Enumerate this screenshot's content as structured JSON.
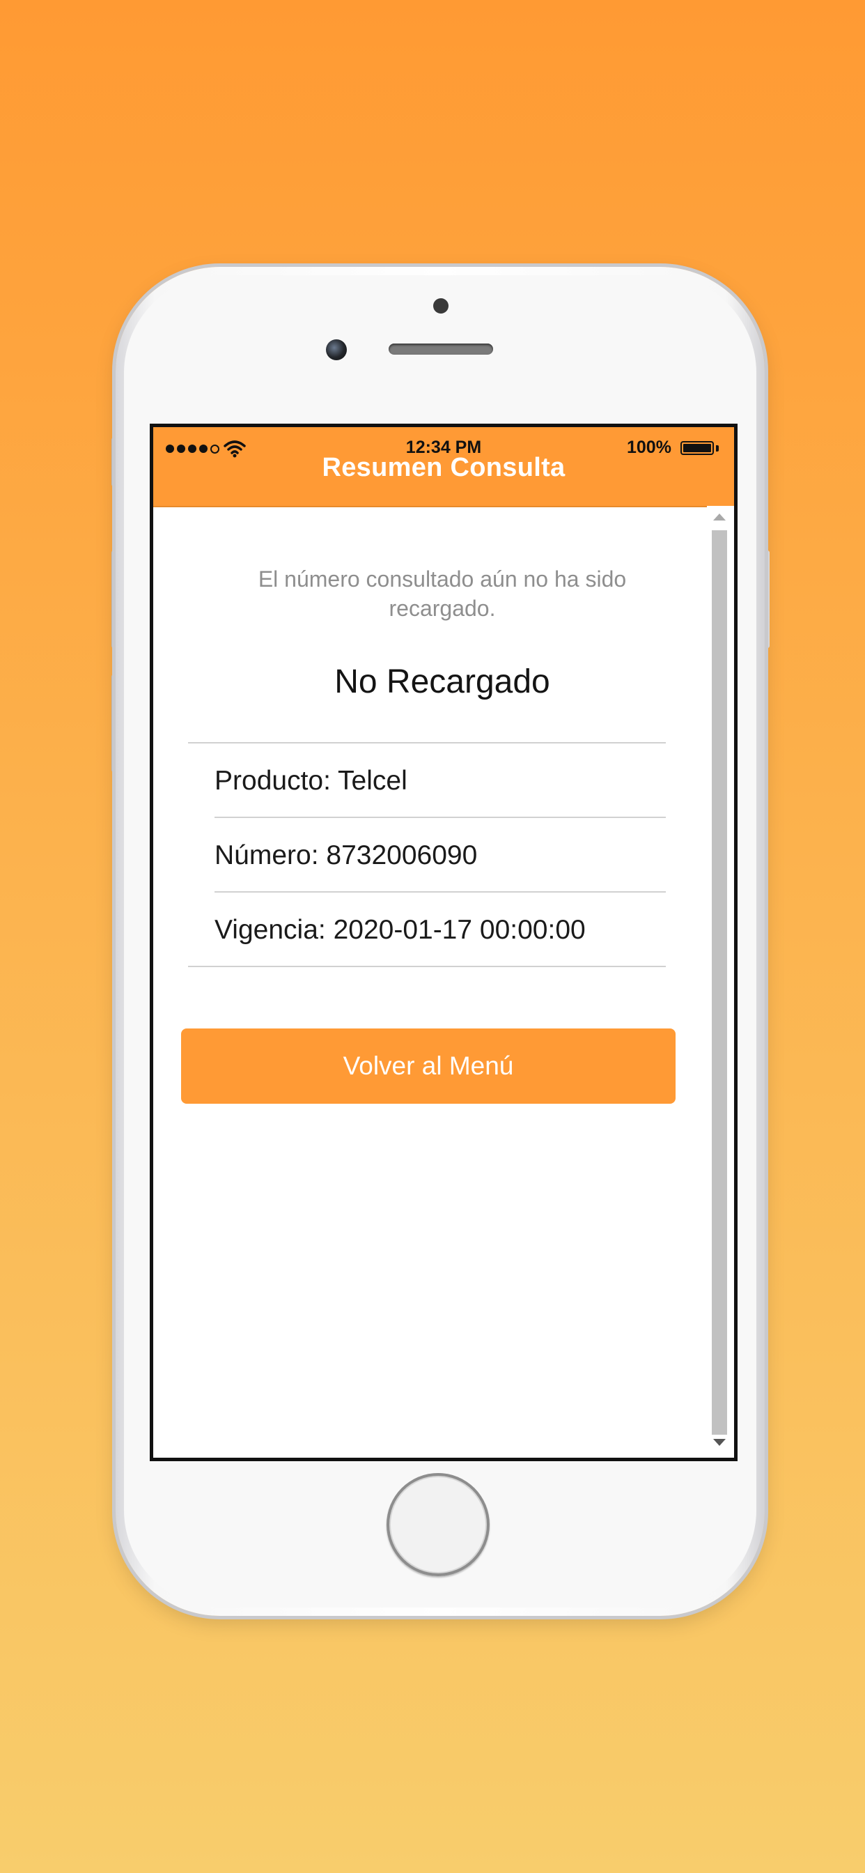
{
  "status_bar": {
    "time": "12:34 PM",
    "battery_percent": "100%",
    "signal_bars": 4,
    "signal_max": 5
  },
  "navbar": {
    "title": "Resumen Consulta"
  },
  "content": {
    "message": "El número consultado aún no ha sido recargado.",
    "status": "No Recargado",
    "details": [
      "Producto: Telcel",
      "Número: 8732006090",
      "Vigencia: 2020-01-17 00:00:00"
    ],
    "menu_button_label": "Volver al Menú"
  },
  "colors": {
    "accent": "#ff9a35",
    "background_top": "#ff9a33",
    "background_bottom": "#f8cd6c"
  }
}
